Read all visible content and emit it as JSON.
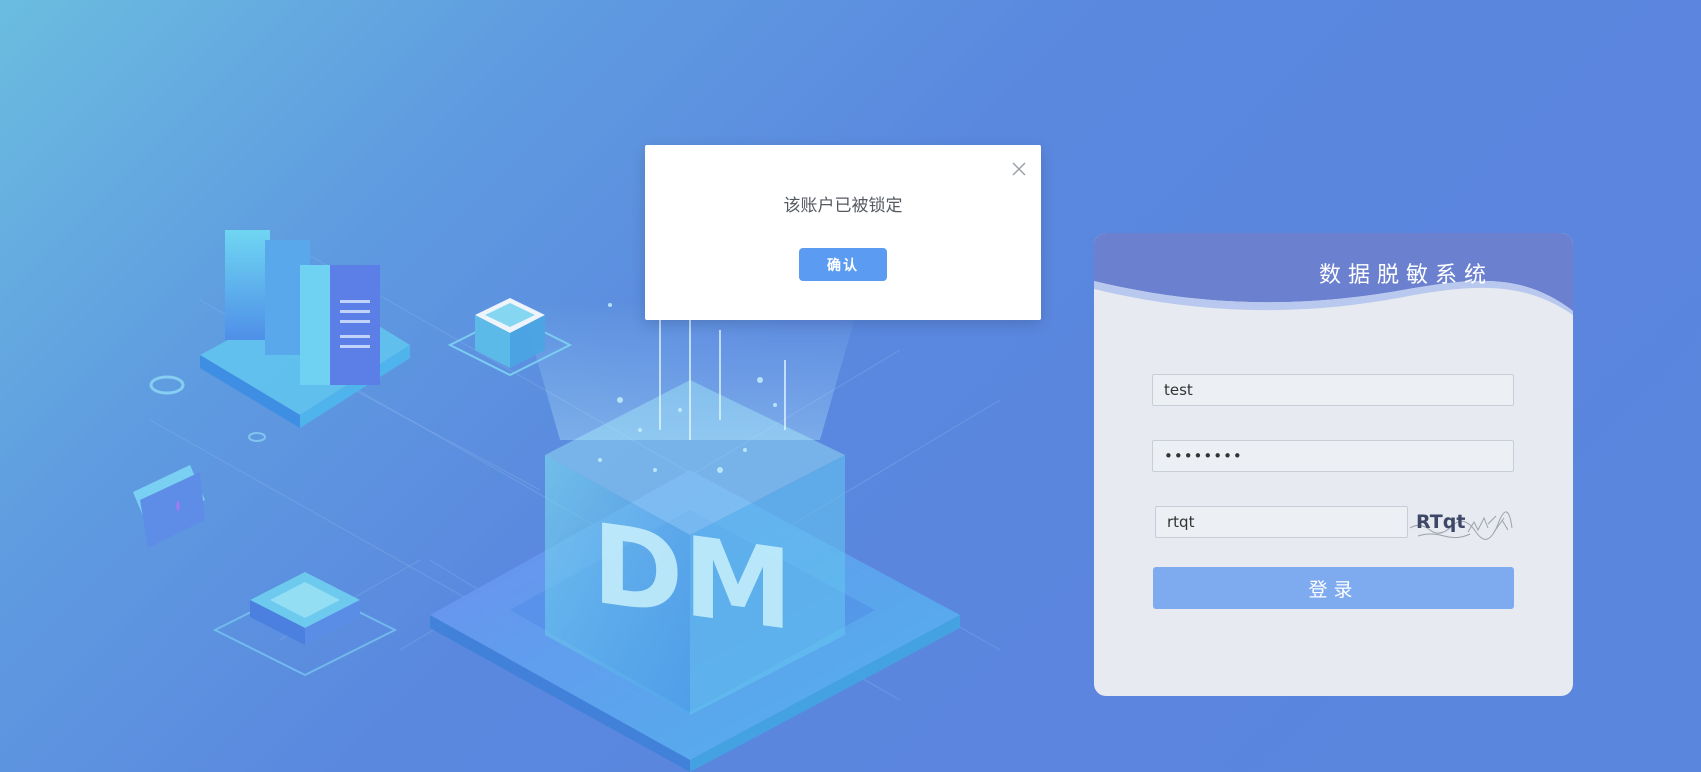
{
  "modal": {
    "message": "该账户已被锁定",
    "confirm_label": "确认"
  },
  "login": {
    "title": "数据脱敏系统",
    "username_value": "test",
    "password_value": "••••••••",
    "captcha_value": "rtqt",
    "captcha_text": "RTqt",
    "submit_label": "登录"
  },
  "illustration": {
    "cube_text": "DM"
  },
  "colors": {
    "accent": "#5b9cf2",
    "login_button": "#7eaaf0",
    "header_wave": "#6b80cf",
    "background": "#5a88df"
  }
}
